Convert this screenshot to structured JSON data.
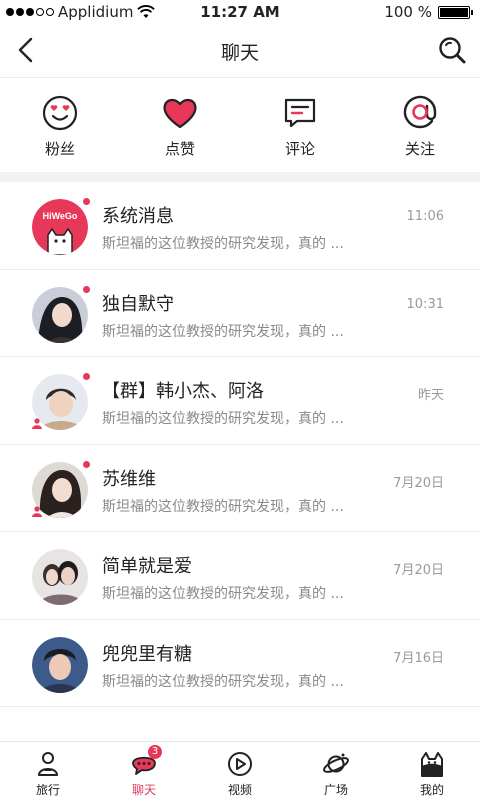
{
  "status_bar": {
    "carrier": "Applidium",
    "time": "11:27 AM",
    "battery": "100 %"
  },
  "nav": {
    "title": "聊天"
  },
  "quick_actions": [
    {
      "label": "粉丝",
      "icon": "heart-eyes-face-icon"
    },
    {
      "label": "点赞",
      "icon": "heart-icon"
    },
    {
      "label": "评论",
      "icon": "comment-icon"
    },
    {
      "label": "关注",
      "icon": "at-icon"
    }
  ],
  "chats": [
    {
      "name": "系统消息",
      "preview": "斯坦福的这位教授的研究发现，真的 ...",
      "time": "11:06",
      "unread": true,
      "group": false
    },
    {
      "name": "独自默守",
      "preview": "斯坦福的这位教授的研究发现，真的 ...",
      "time": "10:31",
      "unread": true,
      "group": false
    },
    {
      "name": "【群】韩小杰、阿洛",
      "preview": "斯坦福的这位教授的研究发现，真的 ...",
      "time": "昨天",
      "unread": true,
      "group": true
    },
    {
      "name": "苏维维",
      "preview": "斯坦福的这位教授的研究发现，真的 ...",
      "time": "7月20日",
      "unread": true,
      "group": true
    },
    {
      "name": "简单就是爱",
      "preview": "斯坦福的这位教授的研究发现，真的 ...",
      "time": "7月20日",
      "unread": false,
      "group": false
    },
    {
      "name": "兜兜里有糖",
      "preview": "斯坦福的这位教授的研究发现，真的 ...",
      "time": "7月16日",
      "unread": false,
      "group": false
    }
  ],
  "system_avatar_text": "HiWeGo",
  "tabs": [
    {
      "label": "旅行",
      "icon": "traveler-icon",
      "active": false
    },
    {
      "label": "聊天",
      "icon": "chat-bubble-icon",
      "active": true,
      "badge": "3"
    },
    {
      "label": "视频",
      "icon": "play-icon",
      "active": false
    },
    {
      "label": "广场",
      "icon": "planet-icon",
      "active": false
    },
    {
      "label": "我的",
      "icon": "cat-face-icon",
      "active": false
    }
  ],
  "colors": {
    "accent": "#e8385a",
    "divider": "#f2f2f4"
  }
}
